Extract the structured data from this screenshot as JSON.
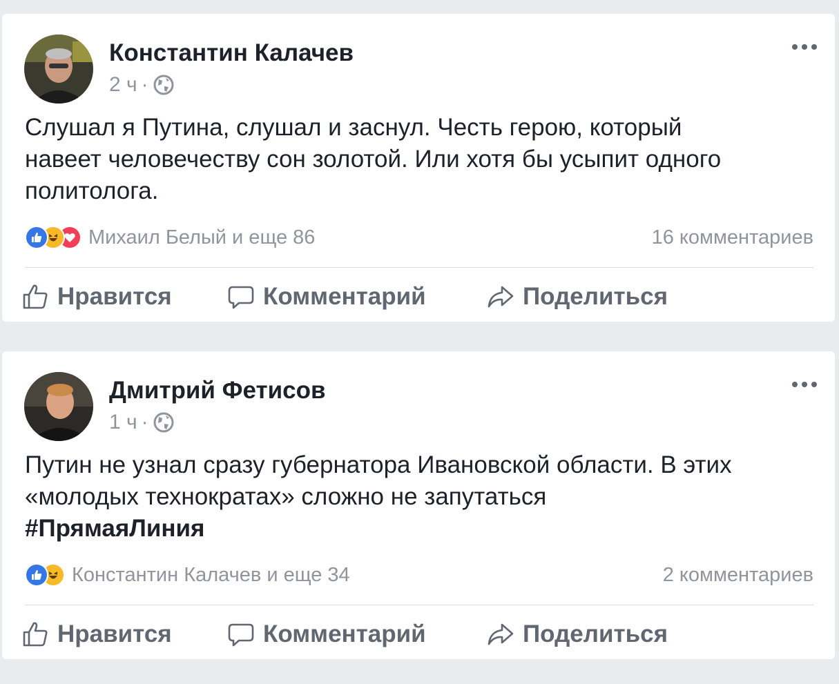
{
  "posts": [
    {
      "author": "Константин Калачев",
      "time": "2 ч",
      "separator": "·",
      "privacy_icon": "globe-icon",
      "text_lines": [
        "Слушал я Путина, слушал и заснул. Честь герою, который",
        "навеет человечеству сон золотой. Или хотя бы усыпит одного",
        "политолога."
      ],
      "hashtag": "",
      "reactions": [
        "like",
        "haha",
        "love"
      ],
      "reactors": "Михаил Белый и еще 86",
      "comments": "16 комментариев"
    },
    {
      "author": "Дмитрий Фетисов",
      "time": "1 ч",
      "separator": "·",
      "privacy_icon": "globe-icon",
      "text_lines": [
        "Путин не узнал сразу губернатора Ивановской области. В этих",
        "«молодых технократах» сложно не запутаться"
      ],
      "hashtag": "#ПрямаяЛиния",
      "reactions": [
        "like",
        "haha"
      ],
      "reactors": "Константин Калачев и еще 34",
      "comments": "2 комментариев"
    }
  ],
  "actions": {
    "like": "Нравится",
    "comment": "Комментарий",
    "share": "Поделиться"
  },
  "colors": {
    "background": "#e9ebee",
    "card": "#ffffff",
    "text": "#1d2129",
    "meta": "#90949c",
    "action": "#606770",
    "like": "#3578e5",
    "haha": "#f7b928",
    "love": "#f33e58"
  }
}
